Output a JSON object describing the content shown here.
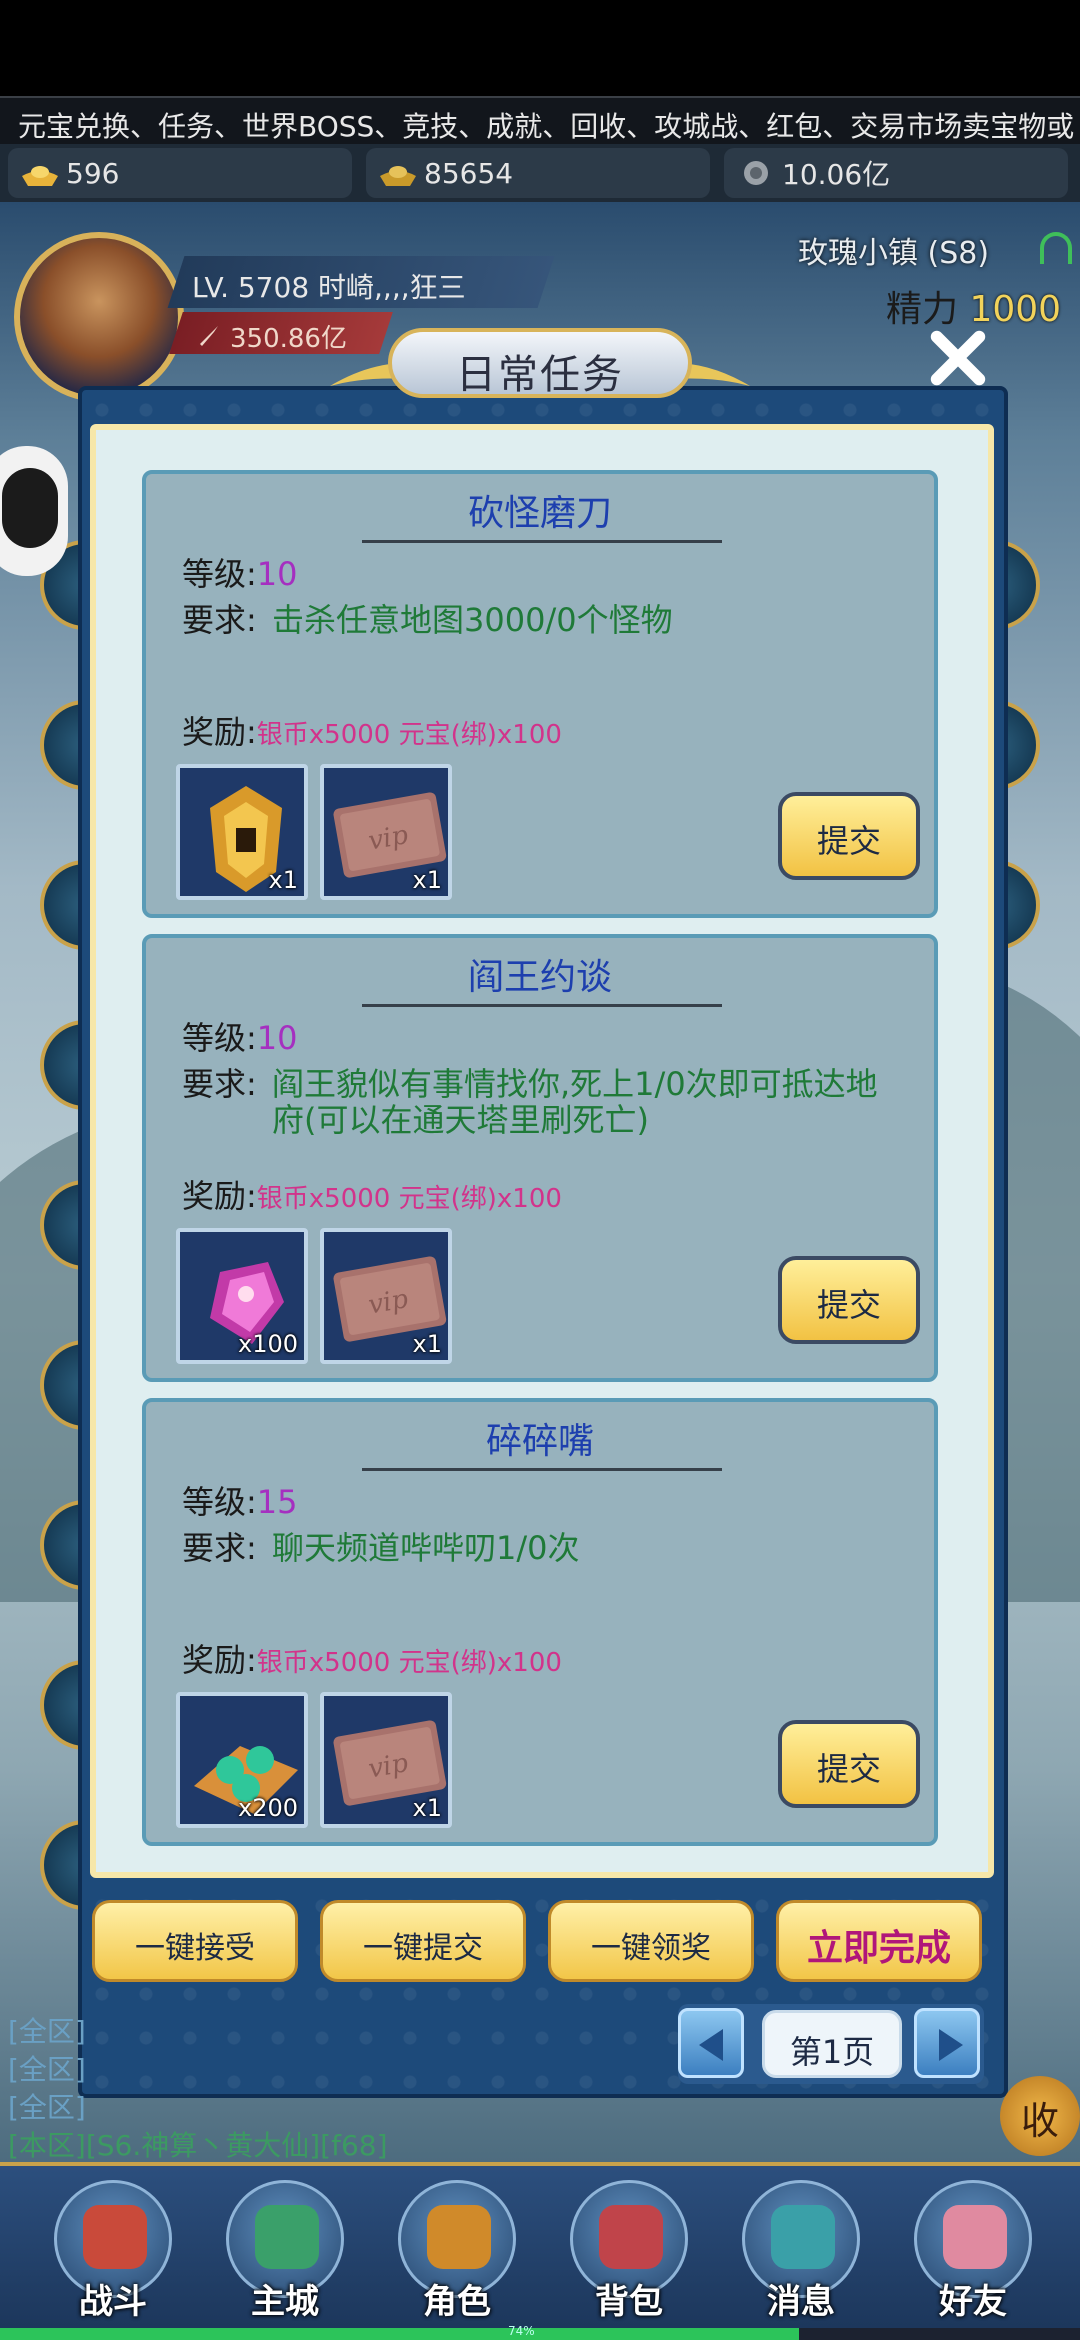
{
  "marquee": "元宝兑换、任务、世界BOSS、竞技、成就、回收、攻城战、红包、交易市场卖宝物或",
  "currencies": [
    {
      "icon": "gold-ingot-icon",
      "value": "596"
    },
    {
      "icon": "bound-ingot-icon",
      "value": "85654"
    },
    {
      "icon": "silver-coin-icon",
      "value": "10.06亿"
    }
  ],
  "player": {
    "level_name": "LV. 5708 时崎,,,,狂三",
    "power": "350.86亿",
    "location": "玫瑰小镇 (S8)",
    "energy_label": "精力",
    "energy_value": "1000"
  },
  "dialog": {
    "title": "日常任务",
    "labels": {
      "level": "等级:",
      "require": "要求:",
      "reward": "奖励:"
    },
    "submit_label": "提交",
    "quests": [
      {
        "name": "砍怪磨刀",
        "level": "10",
        "require": "击杀任意地图3000/0个怪物",
        "reward": "银币x5000 元宝(绑)x100",
        "items": [
          {
            "icon": "golden-medal-icon",
            "qty": "x1"
          },
          {
            "icon": "vip-card-icon",
            "qty": "x1"
          }
        ]
      },
      {
        "name": "阎王约谈",
        "level": "10",
        "require": "阎王貌似有事情找你,死上1/0次即可抵达地府(可以在通天塔里刷死亡)",
        "reward": "银币x5000 元宝(绑)x100",
        "items": [
          {
            "icon": "purple-gem-icon",
            "qty": "x100"
          },
          {
            "icon": "vip-card-icon",
            "qty": "x1"
          }
        ]
      },
      {
        "name": "碎碎嘴",
        "level": "15",
        "require": "聊天频道哔哔叨1/0次",
        "reward": "银币x5000 元宝(绑)x100",
        "items": [
          {
            "icon": "jade-beads-icon",
            "qty": "x200"
          },
          {
            "icon": "vip-card-icon",
            "qty": "x1"
          }
        ]
      }
    ],
    "actions": [
      "一键接受",
      "一键提交",
      "一键领奖",
      "立即完成"
    ],
    "page": "第1页"
  },
  "chat": [
    {
      "text": "[全区]"
    },
    {
      "text": "[全区]"
    },
    {
      "text": "[全区]"
    },
    {
      "text": "[本区][S6.神算丶黄大仙][f68]"
    }
  ],
  "collect_label": "收",
  "nav": [
    {
      "label": "战斗",
      "icon": "battle-icon",
      "color": "#c94a3a"
    },
    {
      "label": "主城",
      "icon": "city-icon",
      "color": "#3aa06a"
    },
    {
      "label": "角色",
      "icon": "character-icon",
      "color": "#d08a2a"
    },
    {
      "label": "背包",
      "icon": "bag-icon",
      "color": "#c0444a"
    },
    {
      "label": "消息",
      "icon": "message-icon",
      "color": "#3aa0a8"
    },
    {
      "label": "好友",
      "icon": "friends-icon",
      "color": "#e08aa0"
    }
  ],
  "xp_fill_fraction": 0.74,
  "xp_label": "74%"
}
